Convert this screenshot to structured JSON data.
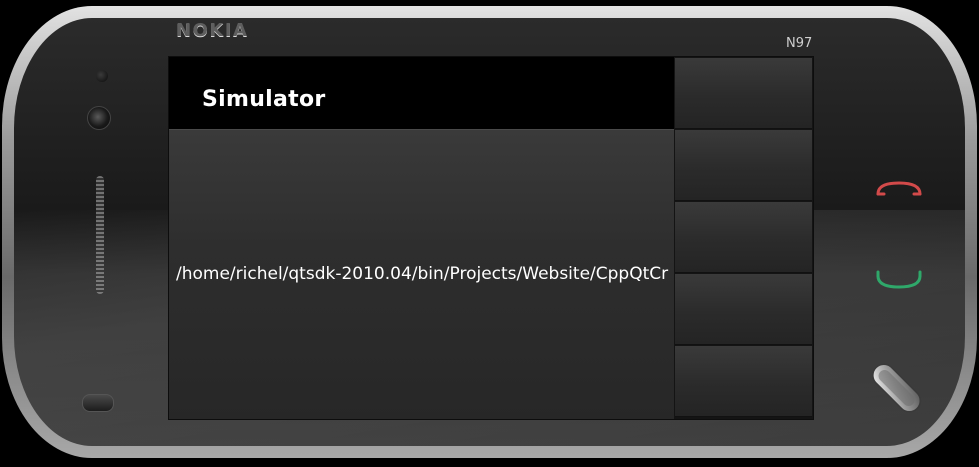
{
  "device": {
    "brand": "NOKIA",
    "model": "N97"
  },
  "screen": {
    "title": "Simulator",
    "path": "/home/richel/qtsdk-2010.04/bin/Projects/Website/CppQtCr",
    "softkeys": [
      "",
      "",
      "",
      "",
      ""
    ]
  },
  "colors": {
    "end_key": "#d24a4a",
    "call_key": "#2fa86a",
    "title_bar": "#000000",
    "text": "#ffffff"
  },
  "icons": {
    "end_key": "end-call-icon",
    "call_key": "call-icon",
    "menu_key": "menu-key-icon",
    "camera": "camera-icon"
  }
}
